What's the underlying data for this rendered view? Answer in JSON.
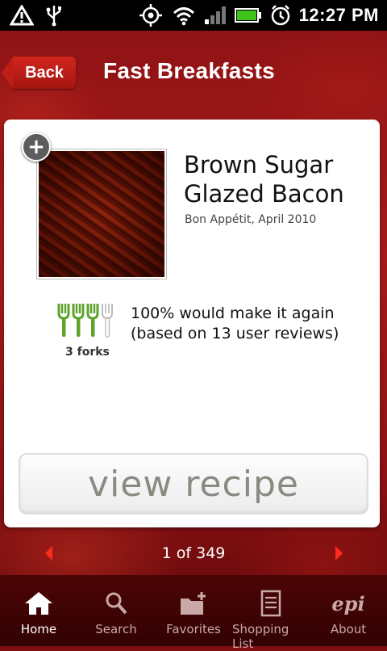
{
  "status_bar": {
    "time": "12:27 PM",
    "icons": [
      "warning-icon",
      "usb-icon",
      "gps-icon",
      "wifi-icon",
      "signal-icon",
      "battery-icon",
      "alarm-icon"
    ]
  },
  "header": {
    "back_label": "Back",
    "title": "Fast Breakfasts"
  },
  "recipe": {
    "title_line1": "Brown Sugar",
    "title_line2": "Glazed Bacon",
    "source": "Bon Appétit, April 2010",
    "forks_label": "3 forks",
    "forks_rating": 3,
    "forks_max": 4,
    "rating_line1": "100% would make it again",
    "rating_line2": "(based on 13 user reviews)",
    "view_button": "view recipe"
  },
  "pager": {
    "label": "1 of 349"
  },
  "nav": {
    "items": [
      {
        "label": "Home",
        "icon": "home-icon",
        "active": true
      },
      {
        "label": "Search",
        "icon": "search-icon",
        "active": false
      },
      {
        "label": "Favorites",
        "icon": "favorites-folder-icon",
        "active": false
      },
      {
        "label": "Shopping List",
        "icon": "shopping-list-icon",
        "active": false
      },
      {
        "label": "About",
        "icon": "epi-logo",
        "logo_text": "epi",
        "active": false
      }
    ]
  },
  "colors": {
    "accent_red": "#d2261f",
    "fork_green": "#5fa32c",
    "nav_bg": "#3d0304"
  }
}
